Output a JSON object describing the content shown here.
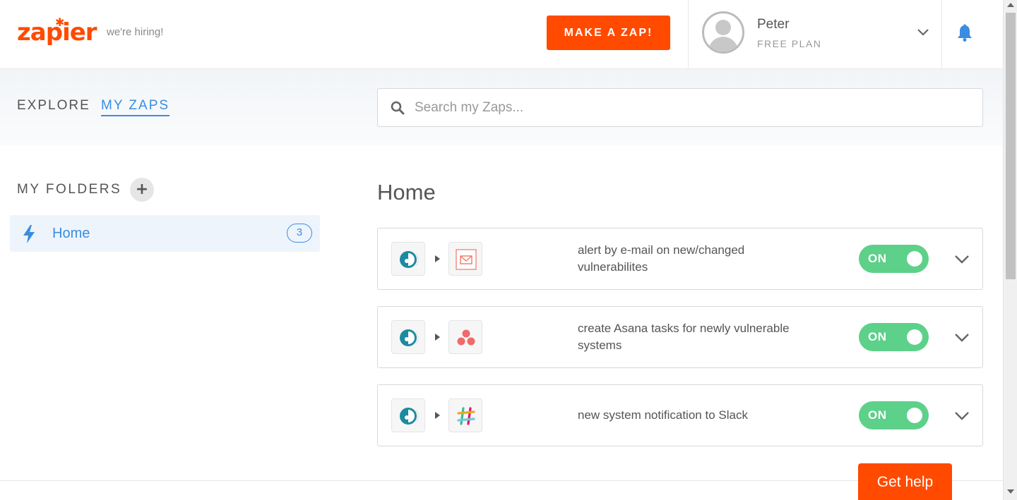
{
  "header": {
    "logo_text": "zapier",
    "hiring_link": "we're hiring!",
    "make_zap_label": "MAKE A ZAP!",
    "user": {
      "name": "Peter",
      "plan": "FREE PLAN"
    }
  },
  "subnav": {
    "tabs": [
      {
        "label": "EXPLORE",
        "active": false
      },
      {
        "label": "MY ZAPS",
        "active": true
      }
    ],
    "search": {
      "placeholder": "Search my Zaps...",
      "value": ""
    }
  },
  "sidebar": {
    "title": "MY FOLDERS",
    "add_label": "+",
    "folders": [
      {
        "label": "Home",
        "count": "3",
        "icon": "bolt-icon"
      }
    ]
  },
  "main": {
    "title": "Home",
    "zaps": [
      {
        "title": "alert by e-mail on new/changed vulnerabilites",
        "trigger_icon": "trigger-app-icon",
        "action_icon": "email-app-icon",
        "toggle": "ON"
      },
      {
        "title": "create Asana tasks for newly vulnerable systems",
        "trigger_icon": "trigger-app-icon",
        "action_icon": "asana-app-icon",
        "toggle": "ON"
      },
      {
        "title": "new system notification to Slack",
        "trigger_icon": "trigger-app-icon",
        "action_icon": "slack-app-icon",
        "toggle": "ON"
      }
    ]
  },
  "help_label": "Get help",
  "colors": {
    "brand": "#ff4a00",
    "link": "#3a8de0",
    "toggle_on": "#5dd08a"
  }
}
